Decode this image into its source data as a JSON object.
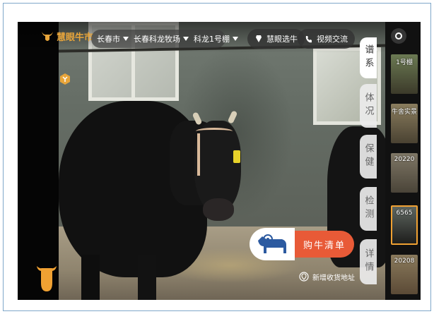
{
  "header": {
    "logo_text": "慧眼牛市",
    "location": {
      "city": "长春市",
      "farm": "长春科龙牧场",
      "barn": "科龙1号棚"
    },
    "smart_select_label": "慧眼选牛",
    "video_chat_label": "视频交流"
  },
  "side_tabs": [
    {
      "label": "谱系",
      "active": true
    },
    {
      "label": "体况",
      "active": false
    },
    {
      "label": "保健",
      "active": false
    },
    {
      "label": "检测",
      "active": false
    },
    {
      "label": "详情",
      "active": false
    }
  ],
  "thumbnails": [
    {
      "label": "1号棚",
      "selected": false
    },
    {
      "label": "牛舍实景",
      "selected": false
    },
    {
      "label": "20220",
      "selected": false
    },
    {
      "label": "6565",
      "selected": true
    },
    {
      "label": "20208",
      "selected": false
    }
  ],
  "buy_list_label": "购牛清单",
  "add_address_label": "新增收货地址",
  "colors": {
    "brand_orange": "#e8a53a",
    "buy_red": "#e85a37",
    "selected_border": "#f0a132"
  },
  "icons": {
    "logo": "bull-head-icon",
    "eye": "eye-toggle-icon",
    "hex": "hexagon-badge-icon",
    "fab": "bull-fab-icon",
    "location": "map-pin-icon",
    "video": "video-call-icon",
    "smart_select": "smart-select-icon"
  }
}
